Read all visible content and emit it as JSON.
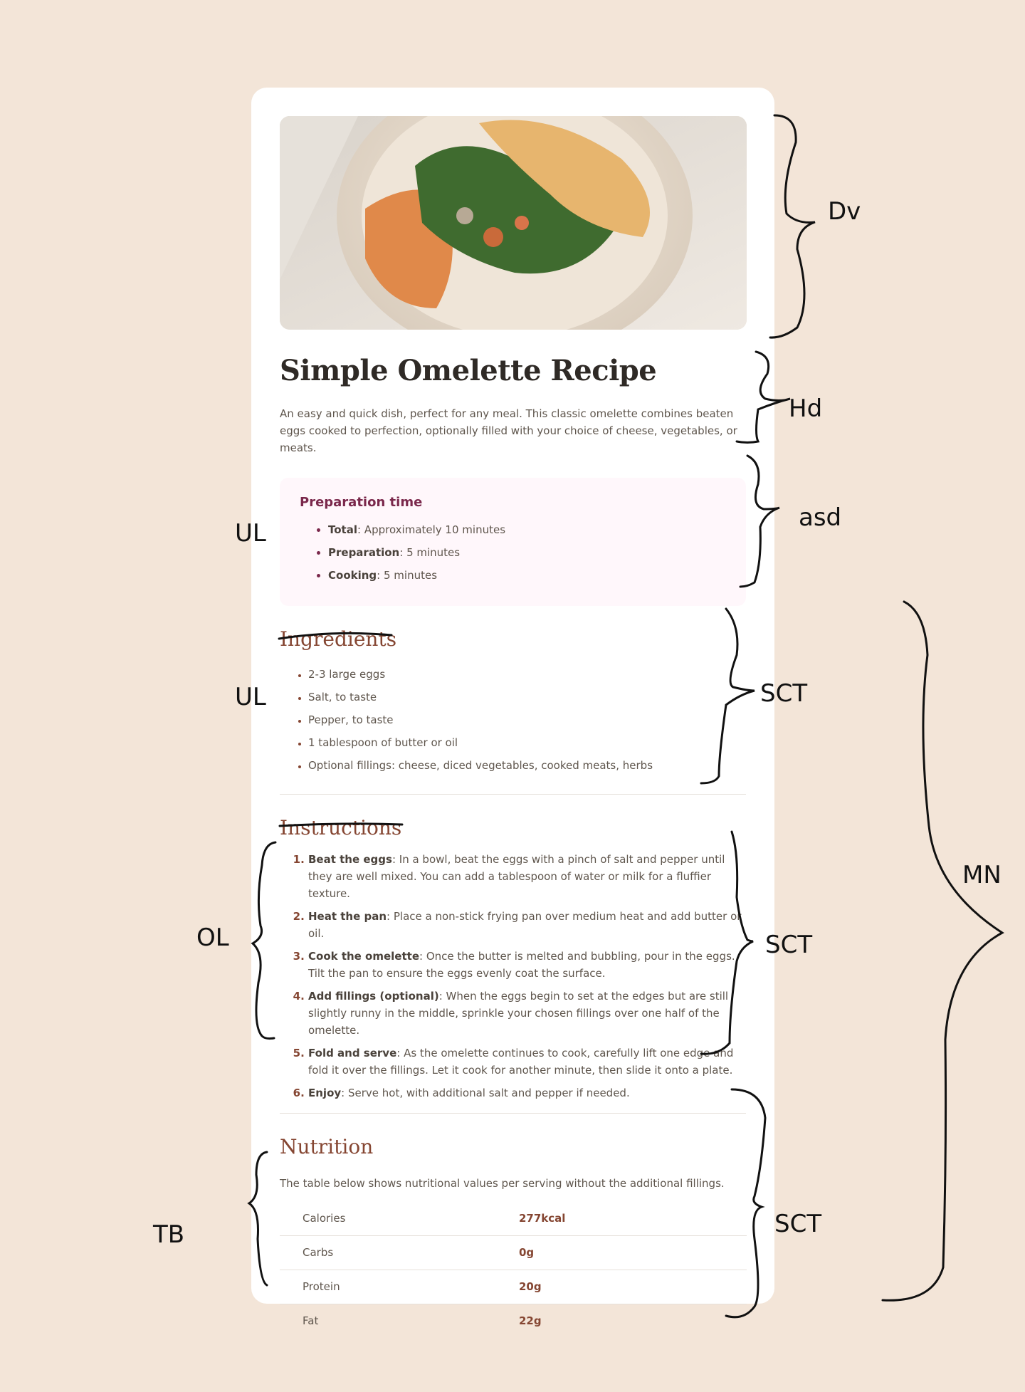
{
  "recipe": {
    "title": "Simple Omelette Recipe",
    "intro": "An easy and quick dish, perfect for any meal. This classic omelette combines beaten eggs cooked to perfection, optionally filled with your choice of cheese, vegetables, or meats."
  },
  "prep": {
    "heading": "Preparation time",
    "items": [
      {
        "label": "Total",
        "text": ": Approximately 10 minutes"
      },
      {
        "label": "Preparation",
        "text": ": 5 minutes"
      },
      {
        "label": "Cooking",
        "text": ": 5 minutes"
      }
    ]
  },
  "ingredients": {
    "heading": "Ingredients",
    "items": [
      "2-3 large eggs",
      "Salt, to taste",
      "Pepper, to taste",
      "1 tablespoon of butter or oil",
      "Optional fillings: cheese, diced vegetables, cooked meats, herbs"
    ]
  },
  "instructions": {
    "heading": "Instructions",
    "steps": [
      {
        "label": "Beat the eggs",
        "text": ": In a bowl, beat the eggs with a pinch of salt and pepper until they are well mixed. You can add a tablespoon of water or milk for a fluffier texture."
      },
      {
        "label": "Heat the pan",
        "text": ": Place a non-stick frying pan over medium heat and add butter or oil."
      },
      {
        "label": "Cook the omelette",
        "text": ": Once the butter is melted and bubbling, pour in the eggs. Tilt the pan to ensure the eggs evenly coat the surface."
      },
      {
        "label": "Add fillings (optional)",
        "text": ": When the eggs begin to set at the edges but are still slightly runny in the middle, sprinkle your chosen fillings over one half of the omelette."
      },
      {
        "label": "Fold and serve",
        "text": ": As the omelette continues to cook, carefully lift one edge and fold it over the fillings. Let it cook for another minute, then slide it onto a plate."
      },
      {
        "label": "Enjoy",
        "text": ": Serve hot, with additional salt and pepper if needed."
      }
    ]
  },
  "nutrition": {
    "heading": "Nutrition",
    "intro": "The table below shows nutritional values per serving without the additional fillings.",
    "rows": [
      {
        "label": "Calories",
        "value": "277kcal"
      },
      {
        "label": "Carbs",
        "value": "0g"
      },
      {
        "label": "Protein",
        "value": "20g"
      },
      {
        "label": "Fat",
        "value": "22g"
      }
    ]
  },
  "annotations": {
    "div": "Dv",
    "hd": "Hd",
    "asd": "asd",
    "ul_prep": "UL",
    "sct_ing": "SCT",
    "ul_ing": "UL",
    "ol": "OL",
    "sct_ins": "SCT",
    "mn": "MN",
    "tb": "TB",
    "sct_nut": "SCT"
  },
  "colors": {
    "background": "#f3e5d8",
    "card": "#ffffff",
    "heading_brown": "#854632",
    "prep_accent": "#7a284b",
    "prep_bg": "#fff7fb"
  }
}
